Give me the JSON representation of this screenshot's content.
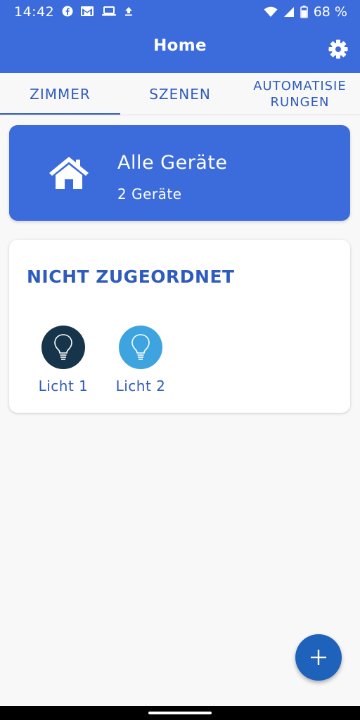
{
  "status_bar": {
    "time": "14:42",
    "battery": "68 %",
    "left_icons": [
      "facebook-icon",
      "gmail-icon",
      "laptop-icon",
      "upload-icon"
    ],
    "right_icons": [
      "wifi-icon",
      "signal-icon",
      "battery-icon"
    ]
  },
  "header": {
    "title": "Home",
    "settings_icon": "gear-icon"
  },
  "tabs": [
    {
      "label": "ZIMMER",
      "active": true
    },
    {
      "label": "SZENEN",
      "active": false
    },
    {
      "label_line1": "AUTOMATISIE",
      "label_line2": "RUNGEN",
      "active": false
    }
  ],
  "all_devices_card": {
    "title": "Alle Geräte",
    "subtitle": "2 Geräte",
    "icon": "home-icon"
  },
  "group": {
    "title": "NICHT ZUGEORDNET",
    "devices": [
      {
        "label": "Licht 1",
        "icon": "lightbulb-icon",
        "color": "#16344a"
      },
      {
        "label": "Licht 2",
        "icon": "lightbulb-icon",
        "color": "#3ea4e0"
      }
    ]
  },
  "fab": {
    "icon": "plus-icon"
  },
  "colors": {
    "primary": "#3c6bdc",
    "accent_text": "#2f5bbf",
    "fab": "#1f62bb",
    "background": "#f8f8f8"
  }
}
